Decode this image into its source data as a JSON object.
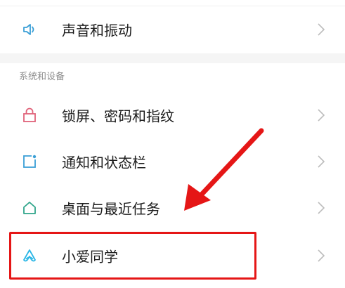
{
  "settings": {
    "sound_row": {
      "label": "声音和振动",
      "icon": "speaker-icon"
    },
    "section_title": "系统和设备",
    "items": [
      {
        "label": "锁屏、密码和指纹",
        "icon": "lock-icon"
      },
      {
        "label": "通知和状态栏",
        "icon": "notification-icon"
      },
      {
        "label": "桌面与最近任务",
        "icon": "home-icon"
      },
      {
        "label": "小爱同学",
        "icon": "xiaoai-icon"
      }
    ]
  },
  "colors": {
    "highlight": "#e51616",
    "arrow": "#e51616",
    "icon_blue": "#3a9fd6",
    "icon_red": "#e0637a",
    "icon_teal": "#2fa58a",
    "icon_cyan": "#29b6e6"
  }
}
